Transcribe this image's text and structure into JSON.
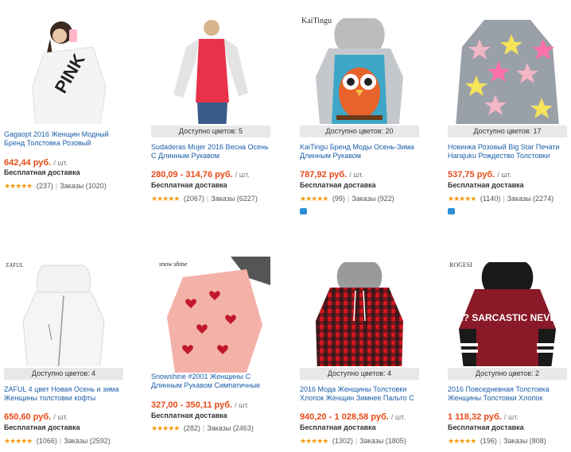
{
  "products": [
    {
      "brand_logo": "",
      "colors_label": "",
      "title": "Gagaopt 2016 Женщин Модный Бренд Толстовка Розовый",
      "price": "642,44 руб.",
      "unit": "/ шт.",
      "shipping": "Бесплатная доставка",
      "reviews": "(237)",
      "orders": "Заказы (1020)",
      "has_chat": false
    },
    {
      "brand_logo": "",
      "colors_label": "Доступно цветов: 5",
      "title": "Sudaderas Mujer 2016 Весна Осень С Длинным Рукавом",
      "price": "280,09 - 314,76 руб.",
      "unit": "/ шт.",
      "shipping": "Бесплатная доставка",
      "reviews": "(2067)",
      "orders": "Заказы (6227)",
      "has_chat": false
    },
    {
      "brand_logo": "KaiTingu",
      "colors_label": "Доступно цветов: 20",
      "title": "KaiTingu Бренд Моды Осень-Зима Длинным Рукавом",
      "price": "787,92 руб.",
      "unit": "/ шт.",
      "shipping": "Бесплатная доставка",
      "reviews": "(99)",
      "orders": "Заказы (922)",
      "has_chat": true
    },
    {
      "brand_logo": "",
      "colors_label": "Доступно цветов: 17",
      "title": "Новинка Розовый Big Star Печати Harajuku Рождество Толстовки",
      "price": "537,75 руб.",
      "unit": "/ шт.",
      "shipping": "Бесплатная доставка",
      "reviews": "(1140)",
      "orders": "Заказы (2274)",
      "has_chat": true
    },
    {
      "brand_logo": "ZAFUL",
      "colors_label": "Доступно цветов: 4",
      "title": "ZAFUL 4 цвет Новая Осень и зима Женщины толстовки кофты",
      "price": "650,60 руб.",
      "unit": "/ шт.",
      "shipping": "Бесплатная доставка",
      "reviews": "(1066)",
      "orders": "Заказы (2592)",
      "has_chat": false
    },
    {
      "brand_logo": "snow shine",
      "colors_label": "",
      "title": "Snowshine #2001 Женщины С Длинным Рукавом Симпатичные",
      "price": "327,00 - 350,11 руб.",
      "unit": "/ шт.",
      "shipping": "Бесплатная доставка",
      "reviews": "(282)",
      "orders": "Заказы (2463)",
      "has_chat": false
    },
    {
      "brand_logo": "",
      "colors_label": "Доступно цветов: 4",
      "title": "2016 Мода Женщины Толстовки Хлопок Женщин Зимнее Пальто С",
      "price": "940,20 - 1 028,58 руб.",
      "unit": "/ шт.",
      "shipping": "Бесплатная доставка",
      "reviews": "(1302)",
      "orders": "Заказы (1805)",
      "has_chat": false
    },
    {
      "brand_logo": "ROGESI",
      "colors_label": "Доступно цветов: 2",
      "title": "2016 Повседневная Толстовка Женщины Толстовки Хлопок",
      "price": "1 118,32 руб.",
      "unit": "/ шт.",
      "shipping": "Бесплатная доставка",
      "reviews": "(196)",
      "orders": "Заказы (808)",
      "has_chat": false
    }
  ],
  "garments": {
    "p1_print": "PINK",
    "p8_print": "ME? SARCASTIC NEVER."
  },
  "palette": {
    "link": "#1a5ea8",
    "price": "#e64a19",
    "stars": "#f29c11",
    "colors_bar": "#e8e8e8"
  }
}
